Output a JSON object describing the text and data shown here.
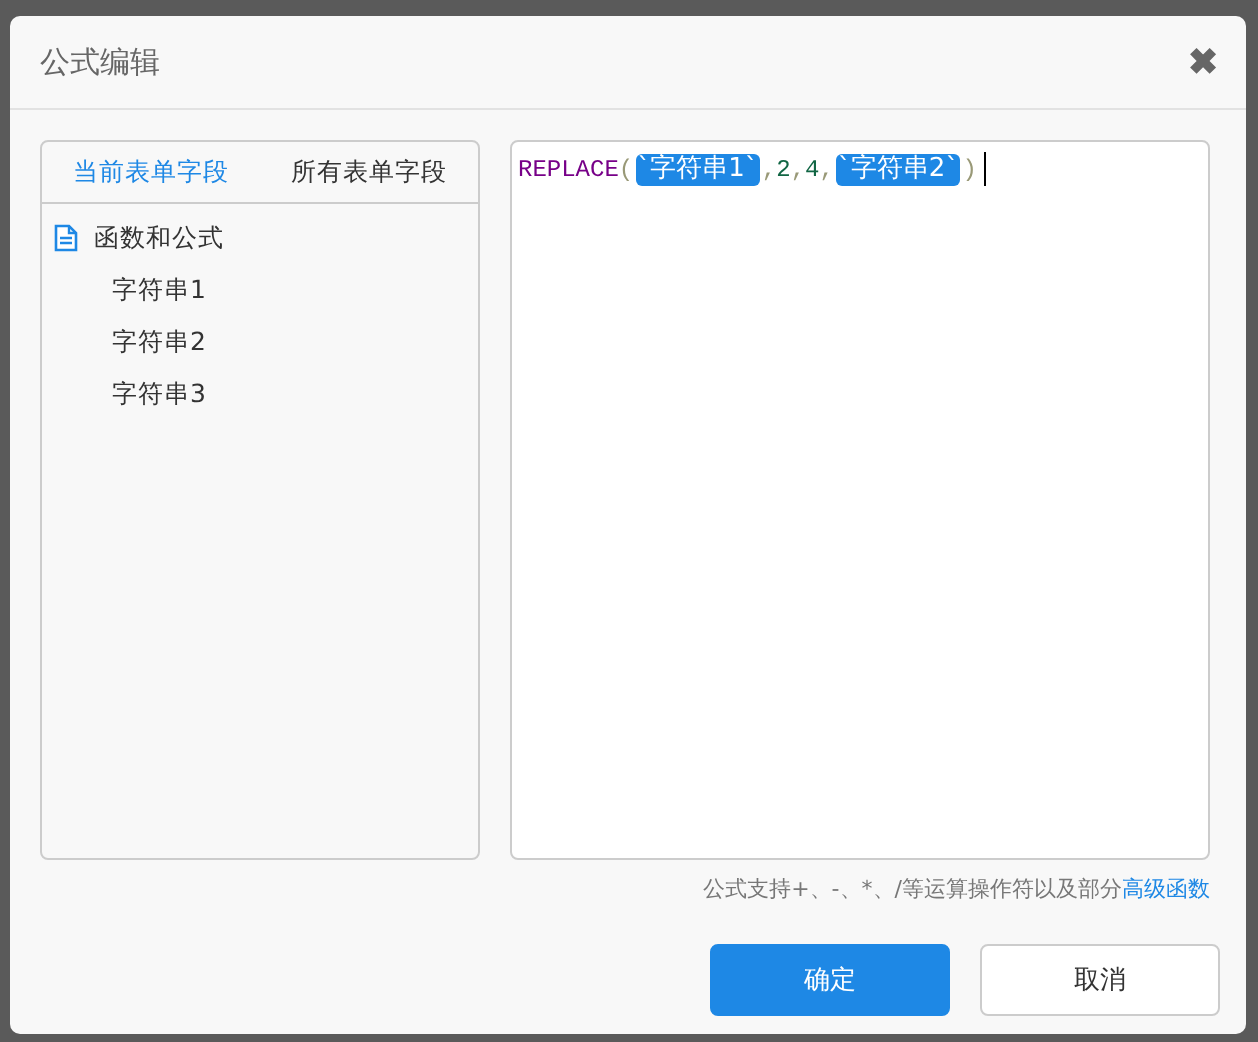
{
  "dialog": {
    "title": "公式编辑",
    "close": "✖"
  },
  "field_panel": {
    "tabs": [
      {
        "label": "当前表单字段",
        "selected": true
      },
      {
        "label": "所有表单字段",
        "selected": false
      }
    ],
    "tree": [
      {
        "label": "函数和公式",
        "children": [
          {
            "label": "字符串1"
          },
          {
            "label": "字符串2"
          },
          {
            "label": "字符串3"
          }
        ]
      }
    ]
  },
  "formula": {
    "tokens": [
      {
        "kind": "function",
        "text": "REPLACE"
      },
      {
        "kind": "punct",
        "text": "("
      },
      {
        "kind": "field",
        "text": "`字符串1`"
      },
      {
        "kind": "punct",
        "text": ","
      },
      {
        "kind": "number",
        "text": "2"
      },
      {
        "kind": "punct",
        "text": ","
      },
      {
        "kind": "number",
        "text": "4"
      },
      {
        "kind": "punct",
        "text": ","
      },
      {
        "kind": "field",
        "text": "`字符串2`"
      },
      {
        "kind": "punct",
        "text": ")"
      }
    ]
  },
  "hint": {
    "text": "公式支持+、-、*、/等运算操作符以及部分",
    "link": "高级函数"
  },
  "buttons": [
    {
      "label": "确定",
      "kind": "primary"
    },
    {
      "label": "取消",
      "kind": "secondary"
    }
  ]
}
